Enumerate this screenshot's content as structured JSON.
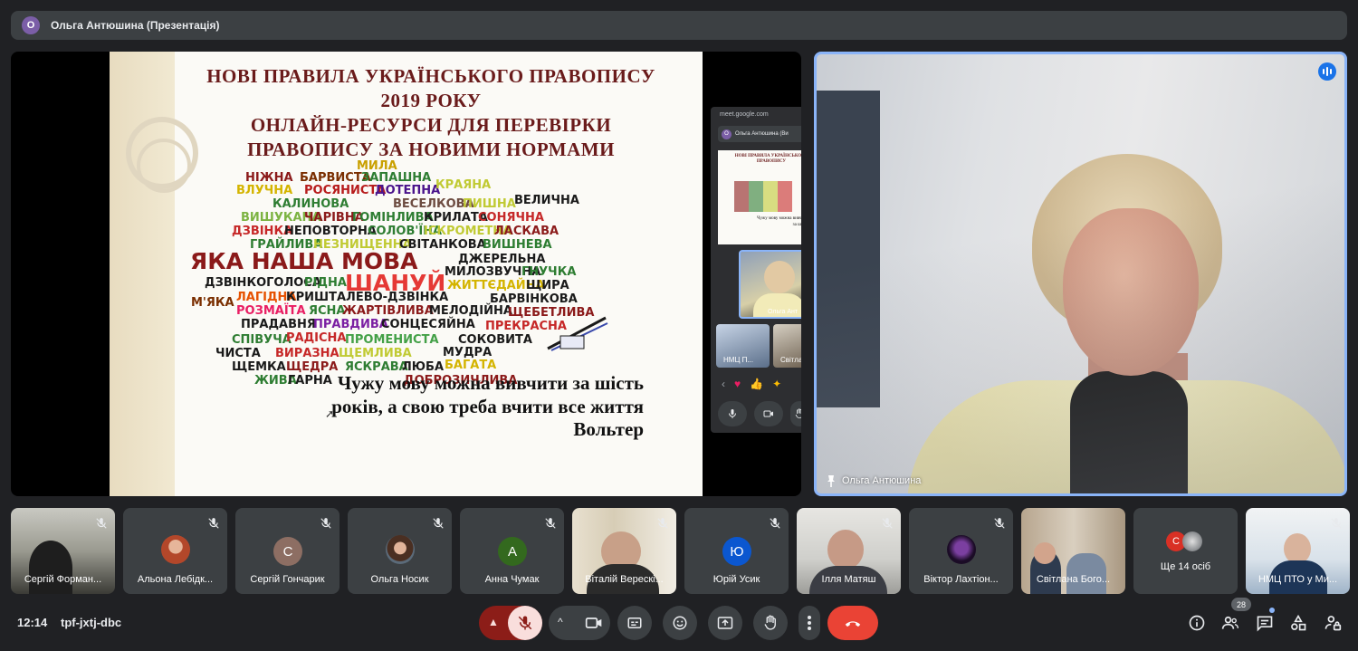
{
  "topbar": {
    "avatar_letter": "О",
    "title": "Ольга Антюшина (Презентація)"
  },
  "slide": {
    "title_lines": [
      "НОВІ ПРАВИЛА УКРАЇНСЬКОГО ПРАВОПИСУ",
      "2019 РОКУ",
      "ОНЛАЙН-РЕСУРСИ ДЛЯ ПЕРЕВІРКИ",
      "ПРАВОПИСУ ЗА НОВИМИ НОРМАМИ"
    ],
    "quote_lines": [
      "Чужу мову можна вивчити за шість",
      "років, а свою треба вчити все життя"
    ],
    "quote_author": "Вольтер"
  },
  "pip": {
    "url": "meet.google.com",
    "bar_title": "Ольга Антюшина (Ви",
    "cam_name": "Ольга Ант",
    "mini1": "НМЦ П...",
    "mini2": "Світла..."
  },
  "speaker": {
    "name": "Ольга Антюшина"
  },
  "participants": [
    {
      "name": "Сергій Форман...",
      "type": "photo",
      "muted": true
    },
    {
      "name": "Альона Лебідк...",
      "type": "avatar-photo",
      "muted": true
    },
    {
      "name": "Сергій Гончарик",
      "type": "letter",
      "letter": "С",
      "color": "#8d6e63",
      "muted": true
    },
    {
      "name": "Ольга Носик",
      "type": "avatar-photo",
      "muted": true
    },
    {
      "name": "Анна Чумак",
      "type": "letter",
      "letter": "А",
      "color": "#33691e",
      "muted": true
    },
    {
      "name": "Віталій Верескі...",
      "type": "photo",
      "muted": true
    },
    {
      "name": "Юрій Усик",
      "type": "letter",
      "letter": "Ю",
      "color": "#0b57d0",
      "muted": true
    },
    {
      "name": "Ілля Матяш",
      "type": "photo",
      "muted": true
    },
    {
      "name": "Віктор Лахтіон...",
      "type": "avatar-photo",
      "muted": true
    },
    {
      "name": "Світлана Бого...",
      "type": "photo",
      "muted": false
    },
    {
      "name": "Ще 14 осіб",
      "type": "more",
      "letter": "С",
      "color": "#d93025",
      "muted": false
    },
    {
      "name": "НМЦ ПТО у Ми...",
      "type": "photo",
      "muted": true
    }
  ],
  "bottom": {
    "time": "12:14",
    "meeting_code": "tpf-jxtj-dbc",
    "people_count": "28"
  },
  "colors": {
    "accent": "#8ab4f8",
    "end_call": "#ea4335",
    "mic_off_bg": "#f9dedc",
    "mic_off_dark": "#8c1d18"
  }
}
